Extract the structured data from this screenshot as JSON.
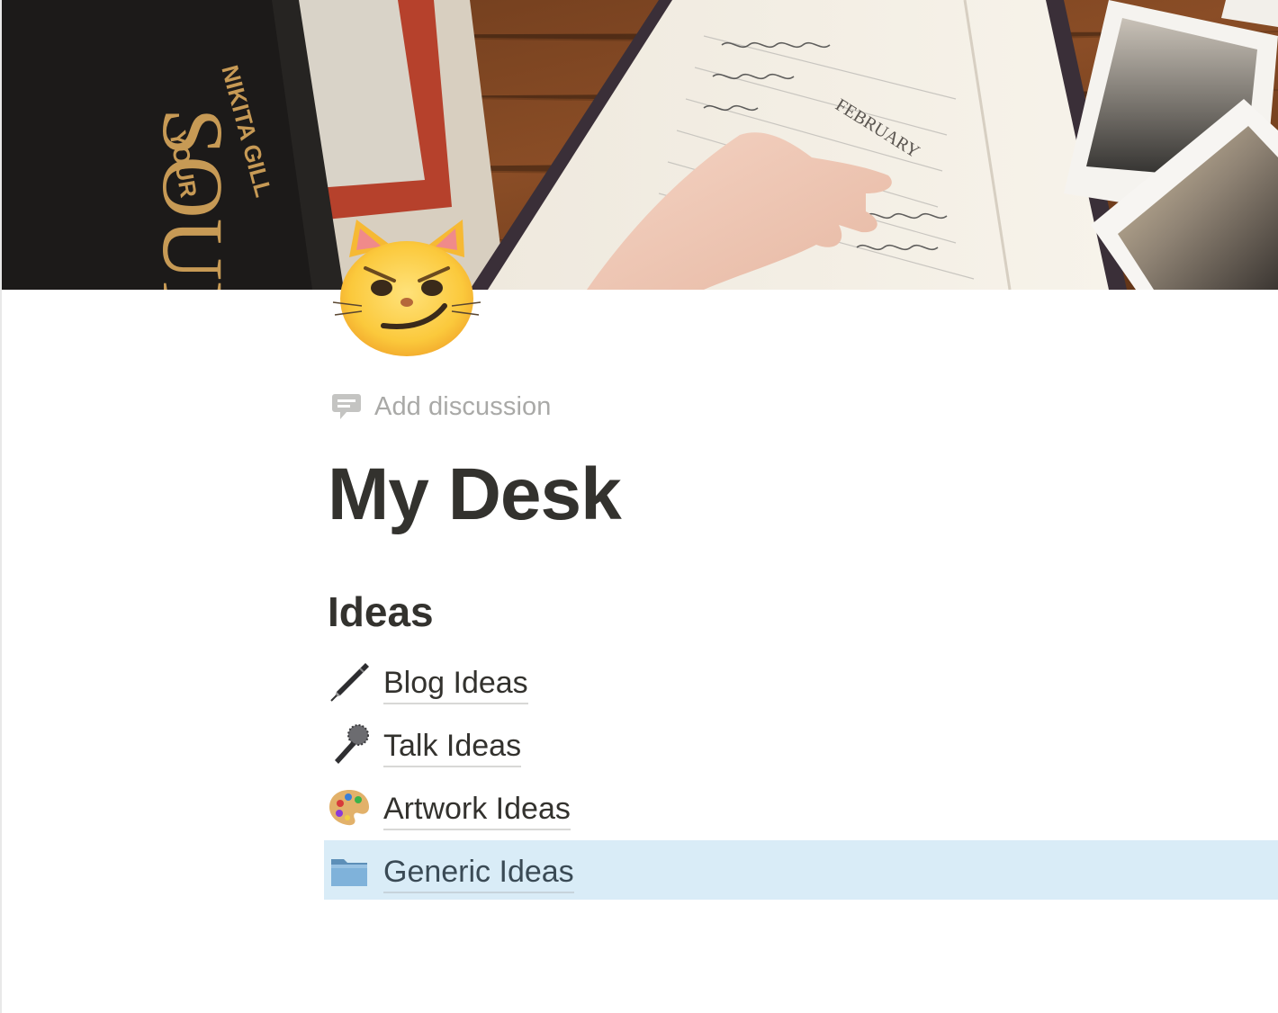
{
  "cover": {
    "book_text_1": "SOUL",
    "book_text_2": "NIKITA GILL",
    "book_text_3": "YOUR",
    "journal_heading": "FEBRUARY"
  },
  "page_icon": "smirking-cat-icon",
  "add_discussion": {
    "label": "Add discussion",
    "icon": "comment-icon"
  },
  "title": "My Desk",
  "sections": [
    {
      "heading": "Ideas",
      "links": [
        {
          "label": "Blog Ideas",
          "icon": "pen-icon"
        },
        {
          "label": "Talk Ideas",
          "icon": "microphone-icon"
        },
        {
          "label": "Artwork Ideas",
          "icon": "palette-icon"
        },
        {
          "label": "Generic Ideas",
          "icon": "folder-icon",
          "selected": true
        }
      ]
    }
  ],
  "colors": {
    "text": "#33322e",
    "muted": "#a9a9a7",
    "selection": "#d9ecf7"
  }
}
